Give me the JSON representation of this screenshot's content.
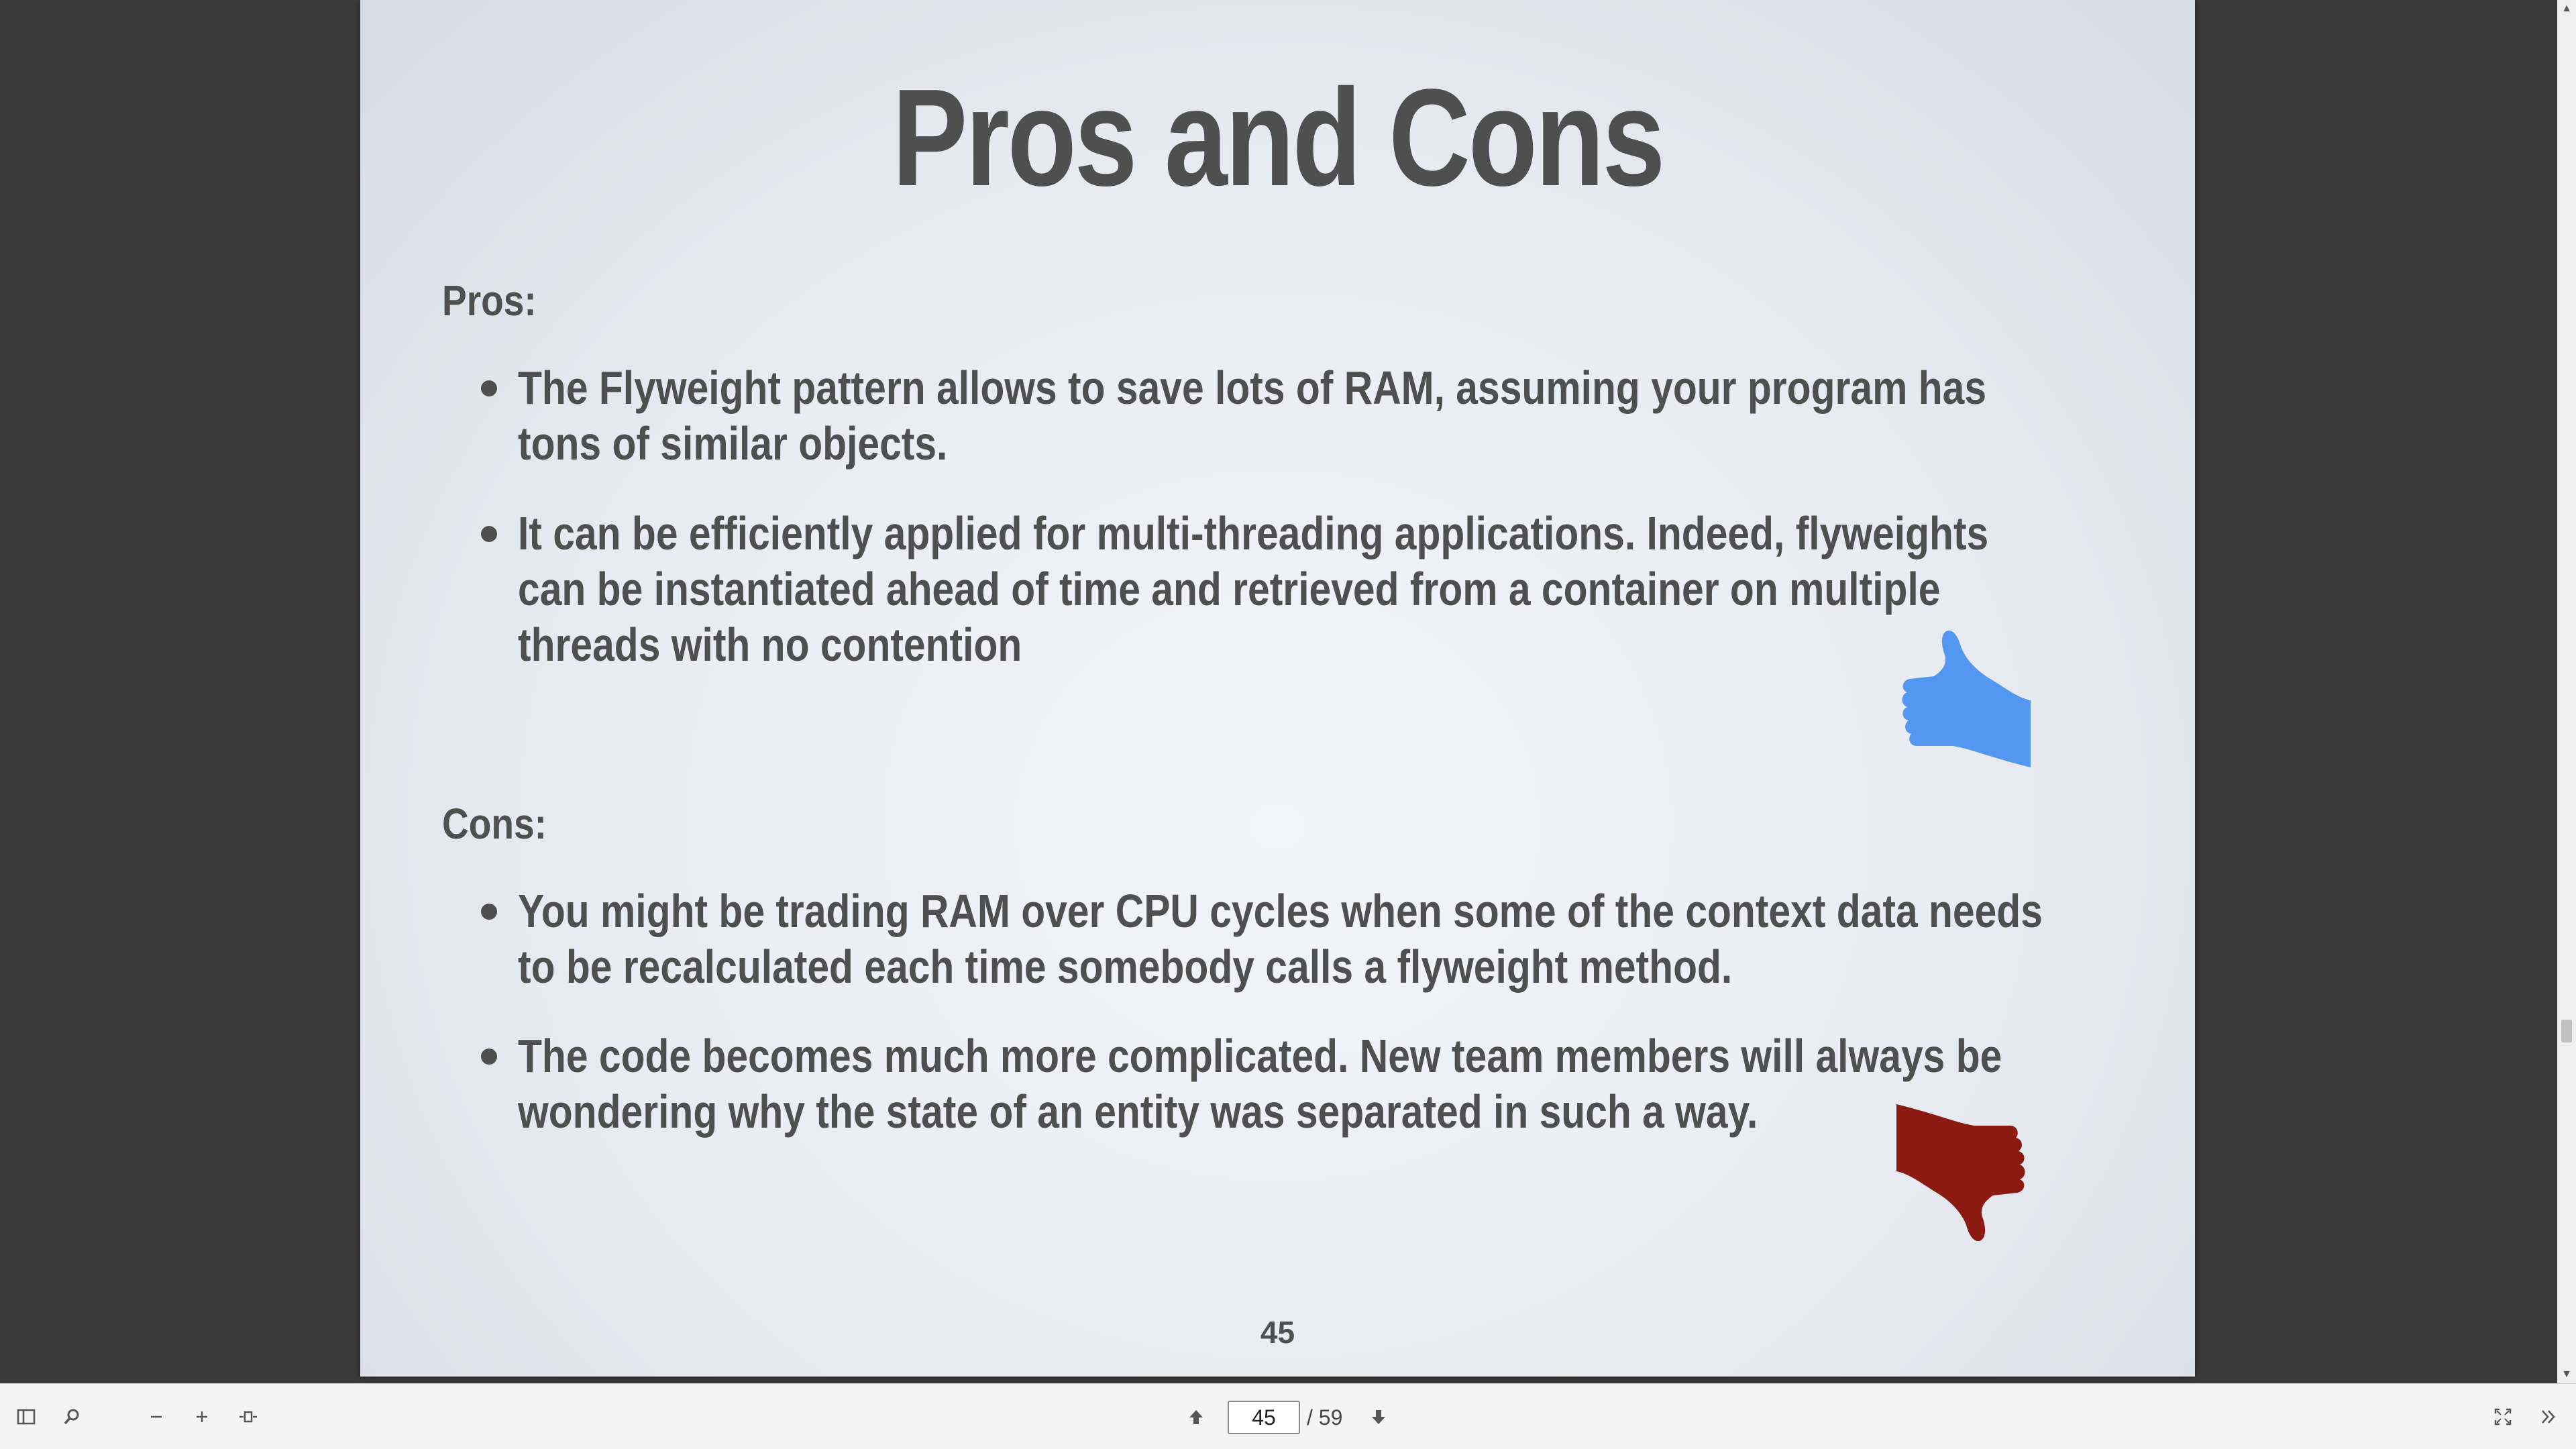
{
  "slide": {
    "title": "Pros and Cons",
    "pros": {
      "heading": "Pros:",
      "items": [
        "The Flyweight pattern allows to save lots of RAM, assuming your program has tons of similar objects.",
        "It can be efficiently applied for multi-threading applications. Indeed, flyweights can be instantiated ahead of time and retrieved from a container on multiple threads with no contention"
      ]
    },
    "cons": {
      "heading": "Cons:",
      "items": [
        "You might be trading RAM over CPU cycles when some of the context data needs to be recalculated each time somebody calls a flyweight method.",
        "The code becomes much more complicated. New team members will always be wondering why the state of an entity was separated in such a way."
      ]
    },
    "slide_number": "45",
    "icons": {
      "thumb_up": "thumbs-up-icon",
      "thumb_down": "thumbs-down-icon"
    },
    "colors": {
      "thumb_up": "#5497f0",
      "thumb_down": "#8b1a10",
      "text": "#4f4f4f"
    }
  },
  "toolbar": {
    "page_current": "45",
    "page_total": "/ 59",
    "icons": {
      "sidebar": "sidebar-toggle-icon",
      "search": "search-icon",
      "zoom_out": "zoom-out-icon",
      "zoom_in": "zoom-in-icon",
      "fit": "fit-width-icon",
      "prev": "arrow-up-icon",
      "next": "arrow-down-icon",
      "fullscreen": "fullscreen-icon",
      "more": "double-chevron-right-icon"
    }
  }
}
